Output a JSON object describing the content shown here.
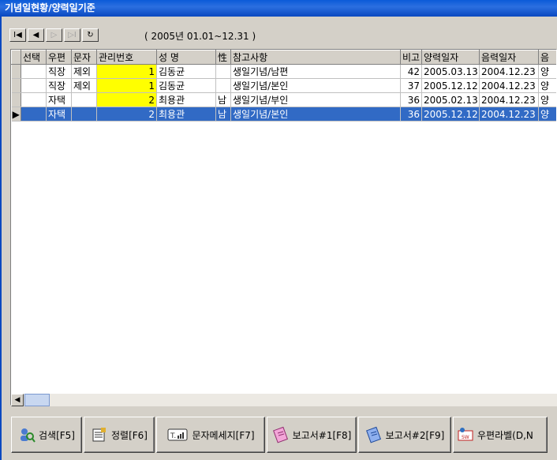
{
  "window": {
    "title": "기념일현황/양력일기준"
  },
  "navigator": {
    "buttons": [
      {
        "glyph": "I◀",
        "name": "first-record-button"
      },
      {
        "glyph": "◀",
        "name": "prev-record-button"
      },
      {
        "glyph": "▷",
        "name": "next-record-button"
      },
      {
        "glyph": "▷I",
        "name": "last-record-button"
      },
      {
        "glyph": "↻",
        "name": "refresh-button"
      }
    ],
    "period": "( 2005년 01.01~12.31 )"
  },
  "grid": {
    "columns": [
      "선택",
      "우편",
      "문자",
      "관리번호",
      "성 명",
      "性",
      "참고사항",
      "비고",
      "양력일자",
      "음력일자",
      "음"
    ],
    "rows": [
      {
        "select": "",
        "post": "직장",
        "sms": "제외",
        "id": "1",
        "name": "김동균",
        "sex": "",
        "note": "생일기념/남편",
        "remark": "42",
        "solar": "2005.03.13",
        "lunar": "2004.12.23",
        "cal": "양"
      },
      {
        "select": "",
        "post": "직장",
        "sms": "제외",
        "id": "1",
        "name": "김동균",
        "sex": "",
        "note": "생일기념/본인",
        "remark": "37",
        "solar": "2005.12.12",
        "lunar": "2004.12.23",
        "cal": "양"
      },
      {
        "select": "",
        "post": "자택",
        "sms": "",
        "id": "2",
        "name": "최용관",
        "sex": "남",
        "note": "생일기념/부인",
        "remark": "36",
        "solar": "2005.02.13",
        "lunar": "2004.12.23",
        "cal": "양"
      },
      {
        "select": "",
        "post": "자택",
        "sms": "",
        "id": "2",
        "name": "최용관",
        "sex": "남",
        "note": "생일기념/본인",
        "remark": "36",
        "solar": "2005.12.12",
        "lunar": "2004.12.23",
        "cal": "양"
      }
    ],
    "selected_row": 3,
    "current_row_indicator": "▶"
  },
  "toolbar": {
    "search": "검색[F5]",
    "sort": "정렬[F6]",
    "sms": "문자메세지[F7]",
    "report1": "보고서#1[F8]",
    "report2": "보고서#2[F9]",
    "label": "우편라벨(D,N"
  },
  "colors": {
    "titlebar": "#0a5bd8",
    "selection": "#316ac5",
    "highlight": "#ffff00"
  }
}
